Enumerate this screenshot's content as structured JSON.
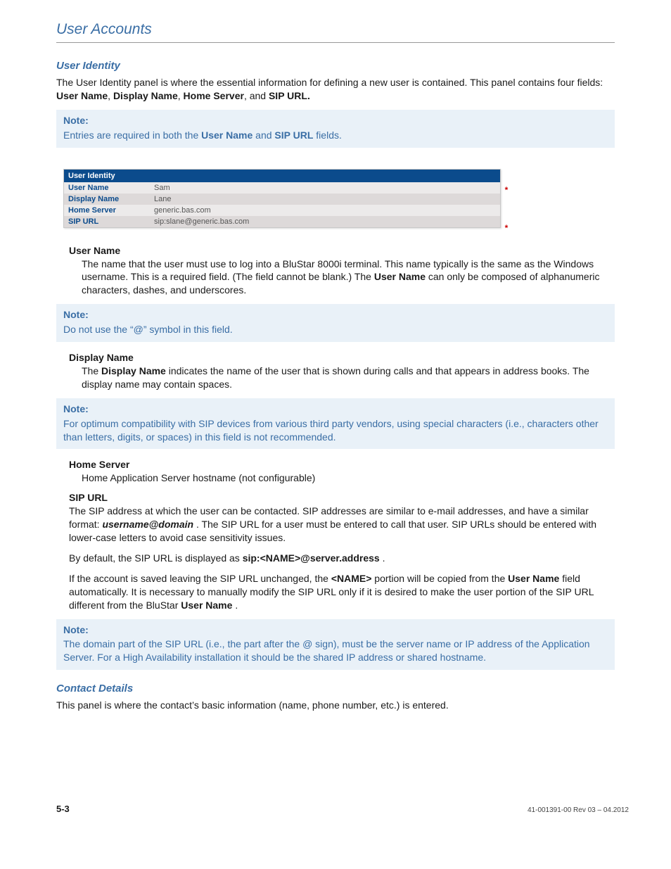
{
  "header": {
    "title": "User Accounts"
  },
  "sections": {
    "userIdentity": {
      "heading": "User Identity",
      "intro_a": "The User Identity panel is where the essential information for defining a new user is contained. This panel contains four fields: ",
      "intro_fields": [
        "User Name",
        "Display Name",
        "Home Server",
        "SIP URL."
      ],
      "note1": {
        "head": "Note:",
        "body_a": "Entries are required in both the ",
        "body_b": " and ",
        "body_c": " fields.",
        "bold1": "User Name",
        "bold2": "SIP URL"
      }
    },
    "panel": {
      "title": "User Identity",
      "rows": [
        {
          "label": "User Name",
          "value": "Sam",
          "required": true
        },
        {
          "label": "Display Name",
          "value": "Lane",
          "required": false
        },
        {
          "label": "Home Server",
          "value": "generic.bas.com",
          "required": false
        },
        {
          "label": "SIP URL",
          "value": "sip:slane@generic.bas.com",
          "required": true
        }
      ]
    },
    "defs": {
      "userName": {
        "term": "User Name",
        "desc_a": "The name that the user must use to log into a BluStar 8000i  terminal. This name typically is the same as the Windows username. This is a required field. (The field cannot be blank.) The ",
        "desc_bold": "User Name",
        "desc_b": " can only be composed of alphanumeric characters, dashes, and underscores."
      },
      "note2": {
        "head": "Note:",
        "body": "Do not use the “@” symbol in this field."
      },
      "displayName": {
        "term": "Display Name",
        "desc_a": "The ",
        "desc_bold": "Display Name",
        "desc_b": " indicates the name of the user that is shown during calls and that appears in address books. The display name may contain spaces."
      },
      "note3": {
        "head": "Note:",
        "body": "For optimum compatibility with SIP devices from various third party vendors, using special characters (i.e., characters other than letters, digits, or spaces) in this field is not recommended."
      },
      "homeServer": {
        "term": "Home Server",
        "desc": "Home Application Server hostname (not configurable)"
      },
      "sipUrl": {
        "term": "SIP URL",
        "p1_a": "The SIP address at which the user can be contacted. SIP addresses are similar to e-mail addresses, and have a similar format: ",
        "p1_bold": "username@domain",
        "p1_b": ". The SIP URL for a user must be entered to call that user. SIP URLs should be entered with lower-case letters to avoid case sensitivity issues.",
        "p2_a": "By default, the SIP URL is displayed as ",
        "p2_bold": "sip:<NAME>@server.address",
        "p2_b": ".",
        "p3_a": "If the account is saved leaving the SIP URL unchanged, the ",
        "p3_bold1": "<NAME>",
        "p3_b": " portion will be copied from the ",
        "p3_bold2": "User Name",
        "p3_c": " field automatically. It is necessary to manually modify the SIP URL only if it is desired to make the user portion of the SIP URL different from the BluStar ",
        "p3_bold3": "User Name",
        "p3_d": "."
      },
      "note4": {
        "head": "Note:",
        "body": "The domain part of the SIP URL (i.e., the part after the @ sign), must be the server name or IP address of the Application Server. For a High Availability installation it should be the shared IP address or shared hostname."
      }
    },
    "contactDetails": {
      "heading": "Contact Details",
      "intro": "This panel is where the contact’s basic information (name, phone number, etc.) is entered."
    }
  },
  "footer": {
    "page": "5-3",
    "rev": "41-001391-00 Rev 03 – 04.2012"
  }
}
